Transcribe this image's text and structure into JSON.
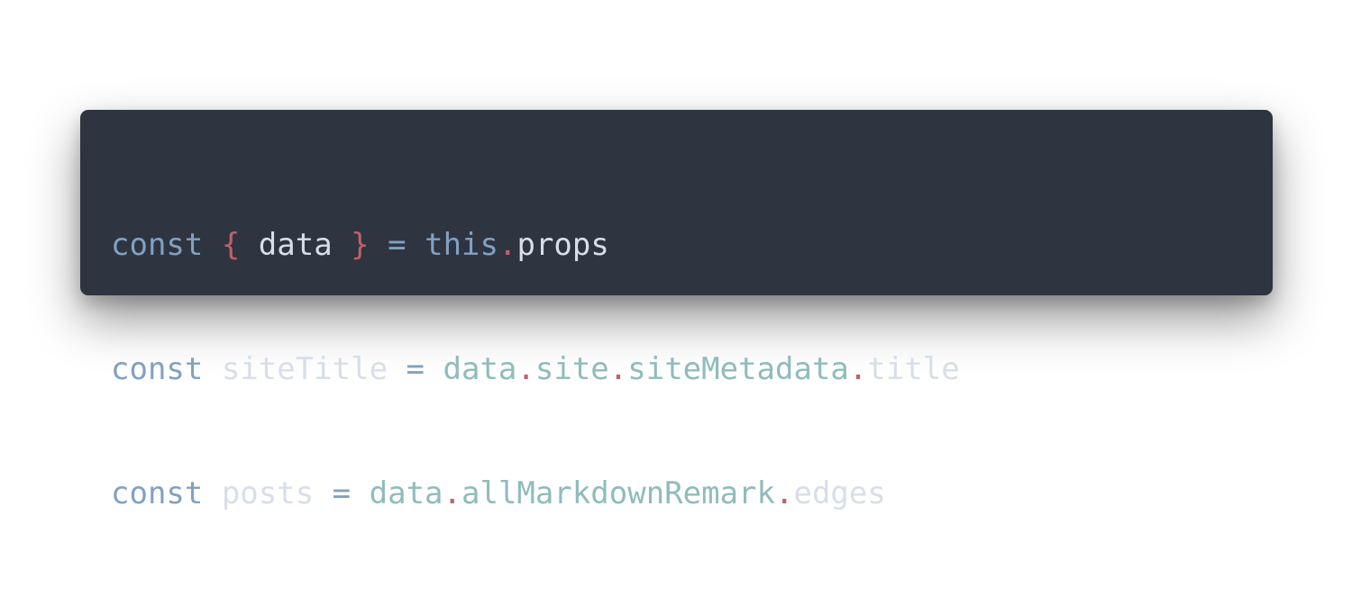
{
  "code_block": {
    "lines": [
      {
        "tokens": [
          {
            "text": "const",
            "kind": "keyword"
          },
          {
            "text": " ",
            "kind": "space"
          },
          {
            "text": "{",
            "kind": "punctuation"
          },
          {
            "text": " data ",
            "kind": "plain"
          },
          {
            "text": "}",
            "kind": "punctuation"
          },
          {
            "text": " ",
            "kind": "space"
          },
          {
            "text": "=",
            "kind": "operator"
          },
          {
            "text": " ",
            "kind": "space"
          },
          {
            "text": "this",
            "kind": "keyword"
          },
          {
            "text": ".",
            "kind": "punctuation"
          },
          {
            "text": "props",
            "kind": "plain"
          }
        ]
      },
      {
        "tokens": [
          {
            "text": "const",
            "kind": "keyword"
          },
          {
            "text": " siteTitle ",
            "kind": "plain"
          },
          {
            "text": "=",
            "kind": "operator"
          },
          {
            "text": " ",
            "kind": "space"
          },
          {
            "text": "data",
            "kind": "property"
          },
          {
            "text": ".",
            "kind": "punctuation"
          },
          {
            "text": "site",
            "kind": "property"
          },
          {
            "text": ".",
            "kind": "punctuation"
          },
          {
            "text": "siteMetadata",
            "kind": "property"
          },
          {
            "text": ".",
            "kind": "punctuation"
          },
          {
            "text": "title",
            "kind": "plain"
          }
        ]
      },
      {
        "tokens": [
          {
            "text": "const",
            "kind": "keyword"
          },
          {
            "text": " posts ",
            "kind": "plain"
          },
          {
            "text": "=",
            "kind": "operator"
          },
          {
            "text": " ",
            "kind": "space"
          },
          {
            "text": "data",
            "kind": "property"
          },
          {
            "text": ".",
            "kind": "punctuation"
          },
          {
            "text": "allMarkdownRemark",
            "kind": "property"
          },
          {
            "text": ".",
            "kind": "punctuation"
          },
          {
            "text": "edges",
            "kind": "plain"
          }
        ]
      }
    ],
    "colors": {
      "background": "#2e3440",
      "keyword": "#81a1c1",
      "operator": "#81a1c1",
      "punctuation": "#bf616a",
      "plain": "#d8dee9",
      "property": "#8fbcbb"
    }
  }
}
